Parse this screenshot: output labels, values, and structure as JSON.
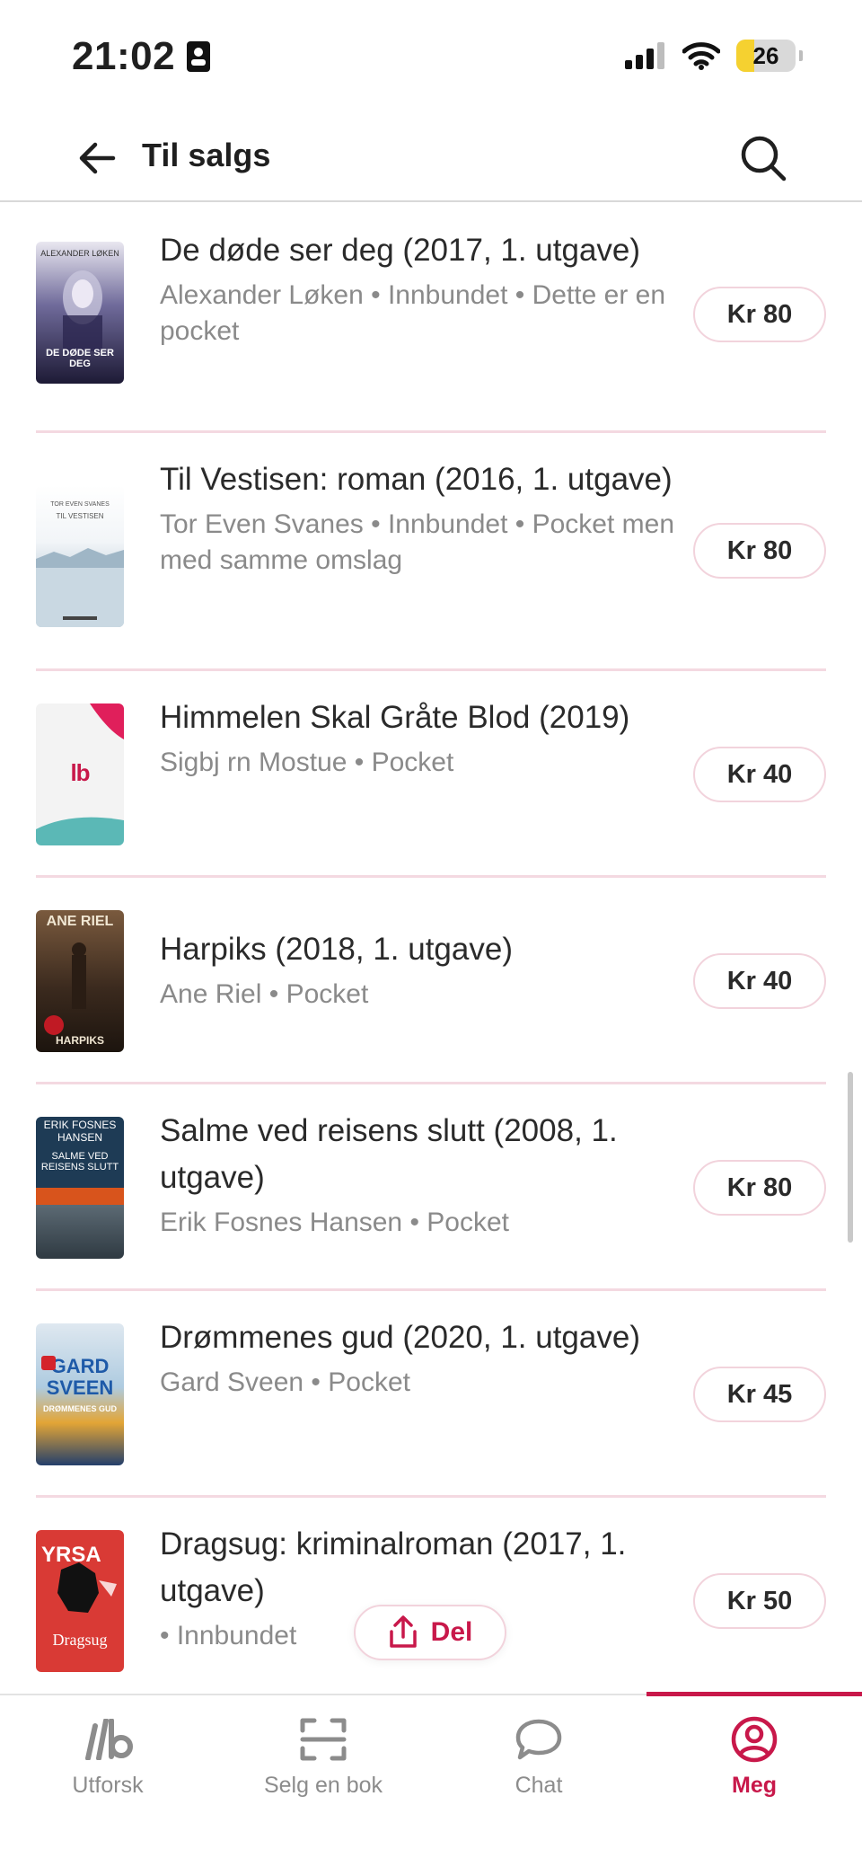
{
  "status_bar": {
    "time": "21:02",
    "battery": "26"
  },
  "header": {
    "title": "Til salgs"
  },
  "books": [
    {
      "title": "De døde ser deg (2017, 1. utgave)",
      "meta": "Alexander Løken • Innbundet • Dette er en pocket",
      "price": "Kr 80",
      "cover_text": "ALEXANDER LØKEN",
      "cover_title": "DE DØDE SER DEG"
    },
    {
      "title": "Til  Vestisen: roman (2016, 1. utgave)",
      "meta": "Tor Even Svanes • Innbundet • Pocket men med samme omslag",
      "price": "Kr 80",
      "cover_text": "TOR EVEN SVANES",
      "cover_title": "TIL VESTISEN"
    },
    {
      "title": "Himmelen Skal Gråte Blod (2019)",
      "meta": "Sigbj rn Mostue • Pocket",
      "price": "Kr 40",
      "cover_text": "lb"
    },
    {
      "title": "Harpiks (2018, 1. utgave)",
      "meta": "Ane Riel • Pocket",
      "price": "Kr 40",
      "cover_text": "ANE RIEL",
      "cover_title": "HARPIKS"
    },
    {
      "title": "Salme ved reisens slutt (2008, 1. utgave)",
      "meta": "Erik Fosnes Hansen • Pocket",
      "price": "Kr 80",
      "cover_text": "ERIK FOSNES HANSEN",
      "cover_title": "SALME VED REISENS SLUTT"
    },
    {
      "title": "Drømmenes gud (2020, 1. utgave)",
      "meta": "Gard Sveen • Pocket",
      "price": "Kr 45",
      "cover_text": "GARD SVEEN",
      "cover_title": "DRØMMENES GUD"
    },
    {
      "title": "Dragsug: kriminalroman (2017, 1. utgave)",
      "meta": "• Innbundet",
      "price": "Kr 50",
      "cover_text": "YRSA",
      "cover_title": "Dragsug"
    }
  ],
  "share_button": {
    "label": "Del"
  },
  "tabs": [
    {
      "label": "Utforsk",
      "icon": "lb-logo-icon"
    },
    {
      "label": "Selg en bok",
      "icon": "scan-icon"
    },
    {
      "label": "Chat",
      "icon": "chat-bubble-icon"
    },
    {
      "label": "Meg",
      "icon": "user-profile-icon"
    }
  ],
  "colors": {
    "accent": "#c8184a",
    "divider": "#f4d9e1"
  }
}
